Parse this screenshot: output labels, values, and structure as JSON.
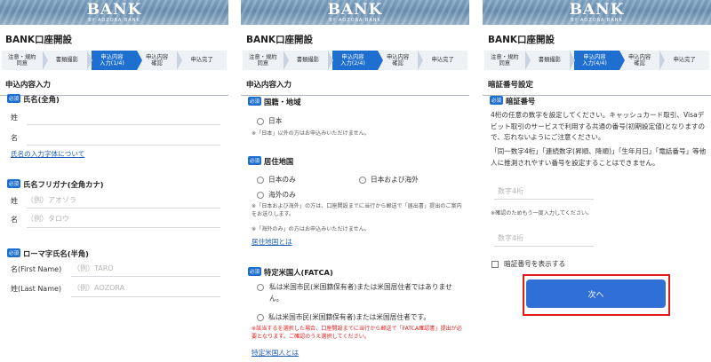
{
  "brand": {
    "logo_text": "BANK",
    "logo_sub": "BY AOZORA BANK"
  },
  "page_title": "BANK口座開設",
  "steps": [
    {
      "label": "注意・規約\n同意"
    },
    {
      "label": "書類撮影"
    },
    {
      "label": "申込内容\n入力(1/4)"
    },
    {
      "label": "申込内容\n確認"
    },
    {
      "label": "申込完了"
    }
  ],
  "steps_p2_active": "申込内容\n入力(2/4)",
  "steps_p3_active": "申込内容\n入力(4/4)",
  "required_badge": "必須",
  "panel1": {
    "section": "申込内容入力",
    "name_label": "氏名(全角)",
    "sei": "姓",
    "mei": "名",
    "name_link": "氏名の入力字体について",
    "kana_label": "氏名フリガナ(全角カナ)",
    "kana_sei_ph": "（例）アオゾラ",
    "kana_mei_ph": "（例）タロウ",
    "roman_label": "ローマ字氏名(半角)",
    "first_name_label": "名(First Name)",
    "first_name_ph": "（例）TARO",
    "last_name_label": "姓(Last Name)",
    "last_name_ph": "（例）AOZORA"
  },
  "panel2": {
    "section": "申込内容入力",
    "nationality_label": "国籍・地域",
    "nationality_option": "日本",
    "nationality_note": "※「日本」以外の方はお申込みいただけません。",
    "residence_label": "居住地国",
    "res_opt1": "日本のみ",
    "res_opt2": "日本および海外",
    "res_opt3": "海外のみ",
    "res_note1": "※「日本および海外」の方は、口座開設までに当行から郵送で「届出書」提出のご案内をお送りします。",
    "res_note2": "※「海外のみ」の方はお申込みいただけません。",
    "res_link": "居住地国とは",
    "fatca_label": "特定米国人(FATCA)",
    "fatca_opt1": "私は米国市民(米国籍保有者)または米国居住者ではありません。",
    "fatca_opt2": "私は米国市民(米国籍保有者)または米国居住者です。",
    "fatca_note": "※該当するを選択した場合、口座開設までに当行から郵送で「FATCA確認書」提出が必要となります。ご確認のうえ選択してください。",
    "fatca_link": "特定米国人とは"
  },
  "panel3": {
    "section": "暗証番号設定",
    "pin_label": "暗証番号",
    "desc1": "4桁の任意の数字を設定してください。キャッシュカード取引、Visaデビット取引のサービスで利用する共通の番号(初期設定値)となりますので、忘れないようにご注意ください。",
    "desc2": "「同一数字4桁」「連続数字(昇順、降順)」「生年月日」「電話番号」等他人に推測されやすい番号を設定することはできません。",
    "pin_ph": "数字4桁",
    "confirm_note": "※確認のためもう一度入力してください。",
    "pin_confirm_ph": "数字4桁",
    "show_pin": "暗証番号を表示する",
    "next_button": "次へ"
  },
  "colors": {
    "accent": "#1e6fd0",
    "highlight_border": "#e21a1a",
    "link": "#1e5eb8",
    "warning": "#e02020"
  }
}
